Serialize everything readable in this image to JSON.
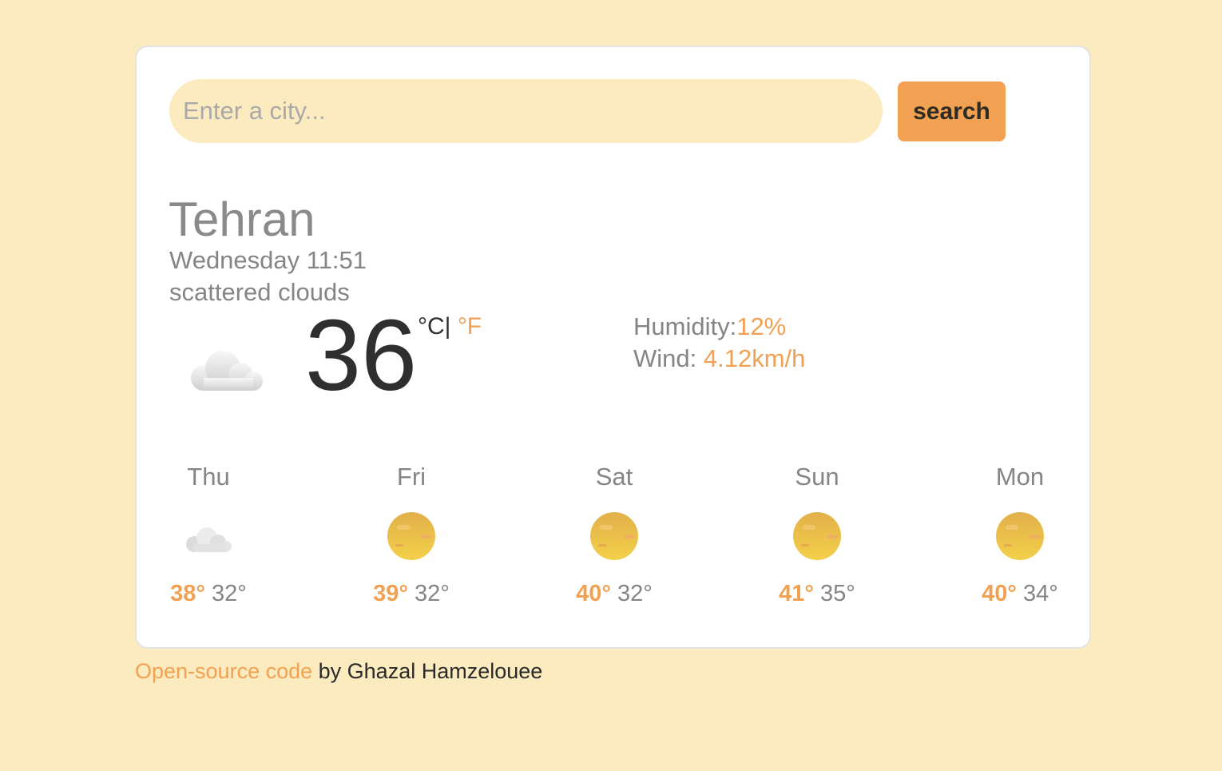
{
  "search": {
    "placeholder": "Enter a city...",
    "button_label": "search"
  },
  "current": {
    "city": "Tehran",
    "datetime": "Wednesday 11:51",
    "description": "scattered clouds",
    "icon": "scattered-clouds-icon",
    "temperature": "36",
    "unit_celsius": "°C",
    "unit_separator": "|",
    "unit_fahrenheit": "°F",
    "humidity_label": "Humidity:",
    "humidity_value": "12%",
    "wind_label": "Wind: ",
    "wind_value": "4.12km/h"
  },
  "forecast": [
    {
      "day": "Thu",
      "icon": "cloud-icon",
      "max": "38°",
      "min": "32°"
    },
    {
      "day": "Fri",
      "icon": "sun-icon",
      "max": "39°",
      "min": "32°"
    },
    {
      "day": "Sat",
      "icon": "sun-icon",
      "max": "40°",
      "min": "32°"
    },
    {
      "day": "Sun",
      "icon": "sun-icon",
      "max": "41°",
      "min": "35°"
    },
    {
      "day": "Mon",
      "icon": "sun-icon",
      "max": "40°",
      "min": "34°"
    }
  ],
  "footer": {
    "link_text": "Open-source code",
    "text": " by Ghazal Hamzelouee"
  },
  "colors": {
    "background": "#fdebc0",
    "accent": "#f1a151",
    "text_muted": "#858585"
  }
}
